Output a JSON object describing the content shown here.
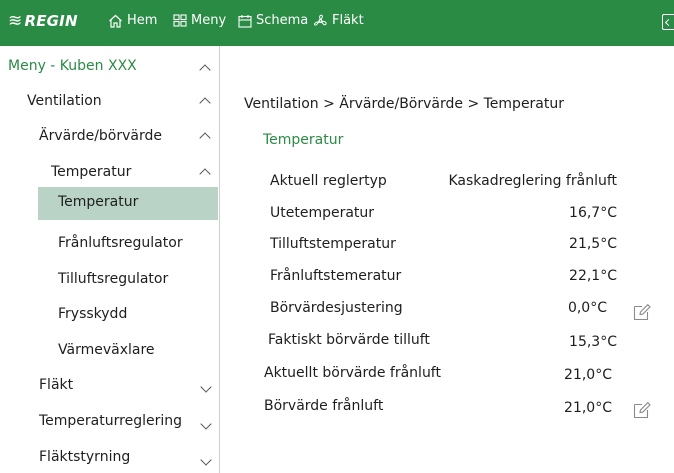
{
  "brand": {
    "name": "REGIN",
    "accent": "#2a8b45",
    "selected_bg": "#b9d4c7"
  },
  "nav": {
    "home": {
      "label": "Hem",
      "icon": "home-icon"
    },
    "menu": {
      "label": "Meny",
      "icon": "grid-icon"
    },
    "schedule": {
      "label": "Schema",
      "icon": "calendar-icon"
    },
    "fan": {
      "label": "Fläkt",
      "icon": "fan-icon"
    }
  },
  "sidebar": {
    "title": "Meny - Kuben XXX",
    "items": [
      {
        "label": "Ventilation",
        "state": "expanded"
      },
      {
        "label": "Ärvärde/börvärde",
        "state": "expanded"
      },
      {
        "label": "Temperatur",
        "state": "expanded"
      },
      {
        "label": "Temperatur",
        "state": "selected"
      },
      {
        "label": "Frånluftsregulator"
      },
      {
        "label": "Tilluftsregulator"
      },
      {
        "label": "Frysskydd"
      },
      {
        "label": "Värmeväxlare"
      },
      {
        "label": "Fläkt",
        "state": "collapsed"
      },
      {
        "label": "Temperaturreglering",
        "state": "collapsed"
      },
      {
        "label": "Fläktstyrning",
        "state": "collapsed"
      }
    ]
  },
  "main": {
    "breadcrumb": "Ventilation > Ärvärde/Börvärde > Temperatur",
    "section_title": "Temperatur",
    "rows": [
      {
        "label": "Aktuell reglertyp",
        "value": "Kaskadreglering frånluft"
      },
      {
        "label": "Utetemperatur",
        "value": "16,7°C"
      },
      {
        "label": "Tilluftstemperatur",
        "value": "21,5°C"
      },
      {
        "label": "Frånluftstemeratur",
        "value": "22,1°C"
      },
      {
        "label": "Börvärdesjustering",
        "value": "0,0°C",
        "editable": true
      },
      {
        "label": "Faktiskt börvärde tilluft",
        "value": "15,3°C"
      },
      {
        "label": "Aktuellt börvärde frånluft",
        "value": "21,0°C"
      },
      {
        "label": "Börvärde frånluft",
        "value": "21,0°C",
        "editable": true
      }
    ]
  }
}
